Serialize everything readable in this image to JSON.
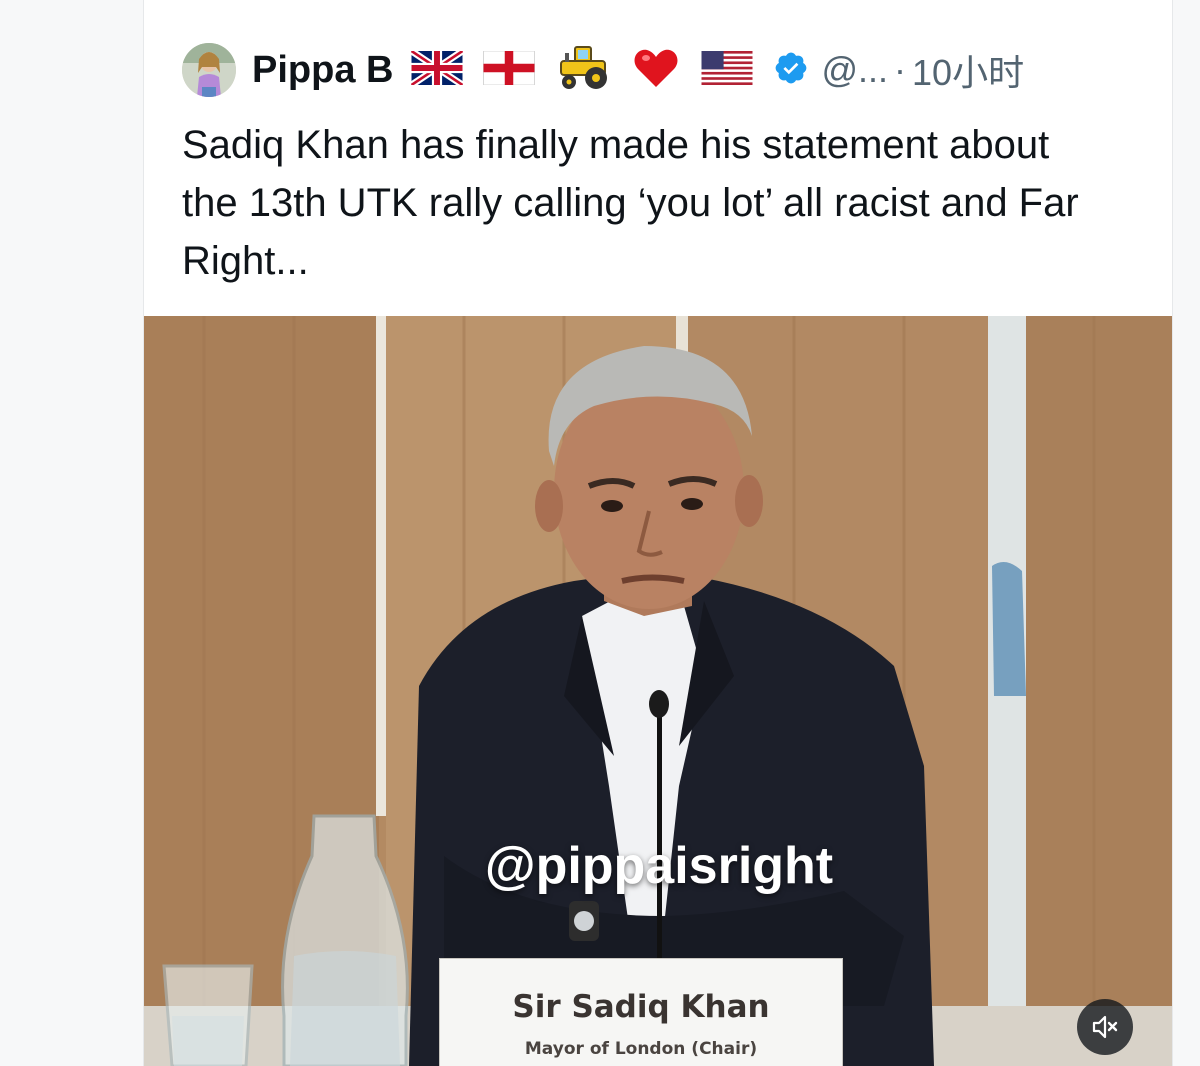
{
  "tweet": {
    "display_name": "Pippa B",
    "badges": [
      "🇬🇧",
      "🏴󠁧󠁢󠁥󠁮󠁧󠁿",
      "🚜",
      "❤️",
      "🇺🇸"
    ],
    "verified_icon": "verified-badge-icon",
    "handle": "@...",
    "separator": "·",
    "timestamp": "10小时",
    "text": "Sadiq Khan has finally made his statement about the 13th UTK rally calling ‘you lot’ all racist and Far Right..."
  },
  "media": {
    "type": "video",
    "watermark": "@pippaisright",
    "nameplate": {
      "name": "Sir Sadiq Khan",
      "role": "Mayor of London (Chair)"
    },
    "mute_icon": "speaker-muted-icon"
  },
  "colors": {
    "text_primary": "#0f1419",
    "text_secondary": "#536471",
    "verified_blue": "#1d9bf0"
  }
}
